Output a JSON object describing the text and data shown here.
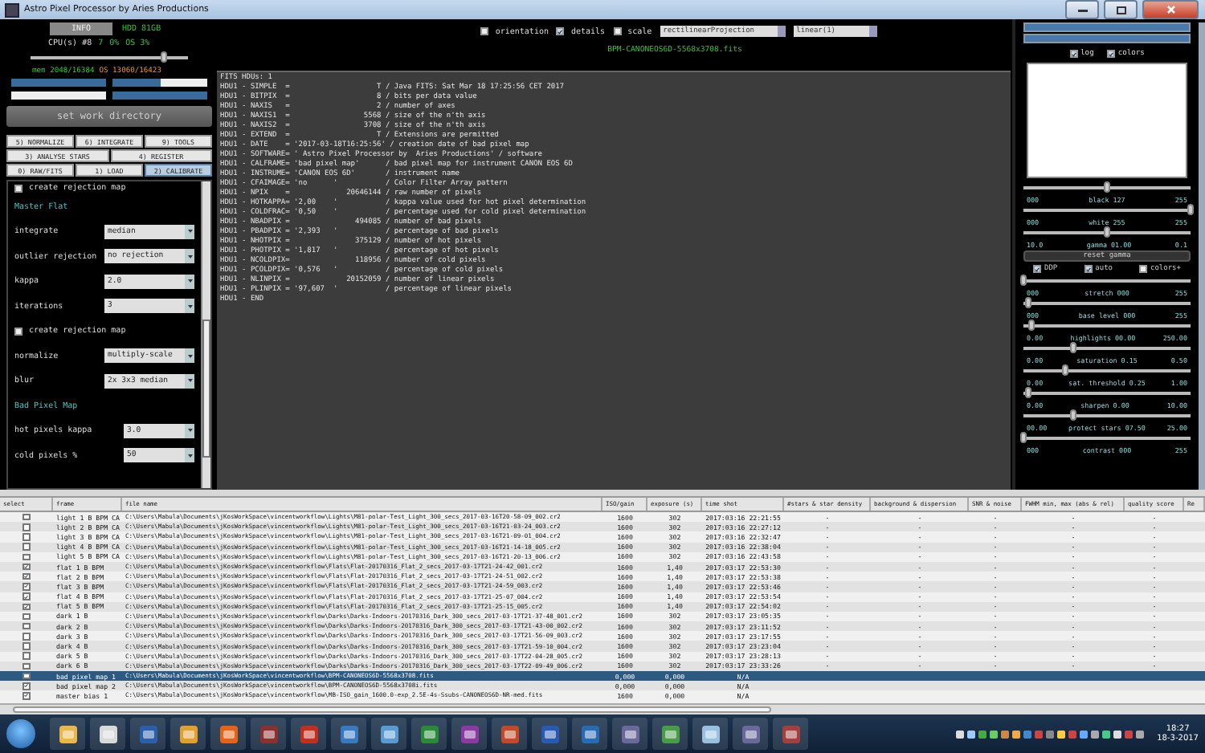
{
  "window": {
    "title": "Astro Pixel Processor by Aries Productions"
  },
  "system": {
    "info_button": "INFO",
    "hdd": "HDD 81GB",
    "cpu": [
      "CPU(s) #8",
      "7",
      "0%",
      "OS 3%"
    ],
    "cpu_slider": {
      "level": 0.85
    },
    "mem": "mem 2048/16384",
    "mem_os": "OS 13060/16423",
    "meters": [
      {
        "level": 1
      },
      {
        "level": 0.5
      },
      {
        "level": 0
      },
      {
        "level": 1
      }
    ],
    "work_dir_button": "set work directory"
  },
  "tabs": [
    [
      {
        "label": "5) NORMALIZE",
        "selected": false
      },
      {
        "label": "6) INTEGRATE",
        "selected": false
      },
      {
        "label": "9) TOOLS",
        "selected": false
      }
    ],
    [
      {
        "label": "3) ANALYSE STARS",
        "selected": false
      },
      {
        "label": "4) REGISTER",
        "selected": false
      }
    ],
    [
      {
        "label": "0) RAW/FITS",
        "selected": false
      },
      {
        "label": "1) LOAD",
        "selected": false
      },
      {
        "label": "2) CALIBRATE",
        "selected": true
      }
    ]
  ],
  "settings": [
    {
      "kind": "checkbox",
      "label": "create rejection map",
      "checked": false
    },
    {
      "kind": "heading",
      "label": "Master Flat"
    },
    {
      "kind": "select",
      "label": "integrate",
      "value": "median"
    },
    {
      "kind": "select",
      "label": "outlier rejection",
      "value": "no rejection"
    },
    {
      "kind": "select",
      "label": "kappa",
      "value": "2.0"
    },
    {
      "kind": "select",
      "label": "iterations",
      "value": "3"
    },
    {
      "kind": "checkbox",
      "label": "create rejection map",
      "checked": false
    },
    {
      "kind": "select",
      "label": "normalize",
      "value": "multiply-scale"
    },
    {
      "kind": "select",
      "label": "blur",
      "value": "2x 3x3 median"
    },
    {
      "kind": "heading",
      "label": "Bad Pixel Map"
    },
    {
      "kind": "select",
      "label": "hot pixels kappa",
      "value": "3.0"
    },
    {
      "kind": "select",
      "label": "cold pixels %",
      "value": "50"
    }
  ],
  "viewer": {
    "options": [
      {
        "label": "orientation",
        "checked": false
      },
      {
        "label": "details",
        "checked": true
      },
      {
        "label": "scale",
        "checked": false
      }
    ],
    "projection": "rectilinearProjection",
    "stretch": "linear(1)",
    "file": "BPM-CANONEOS6D-5568x3708.fits",
    "header_lines": [
      "FITS HDUs: 1",
      "HDU1 - SIMPLE  =                    T / Java FITS: Sat Mar 18 17:25:56 CET 2017",
      "HDU1 - BITPIX  =                    8 / bits per data value",
      "HDU1 - NAXIS   =                    2 / number of axes",
      "HDU1 - NAXIS1  =                 5568 / size of the n'th axis",
      "HDU1 - NAXIS2  =                 3708 / size of the n'th axis",
      "HDU1 - EXTEND  =                    T / Extensions are permitted",
      "HDU1 - DATE    = '2017-03-18T16:25:56' / creation date of bad pixel map",
      "HDU1 - SOFTWARE= ' Astro Pixel Processor by  Aries Productions' / software",
      "HDU1 - CALFRAME= 'bad pixel map'      / bad pixel map for instrument CANON EOS 6D",
      "HDU1 - INSTRUME= 'CANON EOS 6D'       / instrument name",
      "HDU1 - CFAIMAGE= 'no      '           / Color Filter Array pattern",
      "HDU1 - NPIX    =             20646144 / raw number of pixels",
      "HDU1 - HOTKAPPA= '2,00    '           / kappa value used for hot pixel determination",
      "HDU1 - COLDFRAC= '0,50    '           / percentage used for cold pixel determination",
      "HDU1 - NBADPIX =               494085 / number of bad pixels",
      "HDU1 - PBADPIX = '2,393   '           / percentage of bad pixels",
      "HDU1 - NHOTPIX =               375129 / number of hot pixels",
      "HDU1 - PHOTPIX = '1,817   '           / percentage of hot pixels",
      "HDU1 - NCOLDPIX=               118956 / number of cold pixels",
      "HDU1 - PCOLDPIX= '0,576   '           / percentage of cold pixels",
      "HDU1 - NLINPIX =             20152059 / number of linear pixels",
      "HDU1 - PLINPIX = '97,607  '           / percentage of linear pixels",
      "HDU1 - END"
    ]
  },
  "adjust": {
    "histogram_options": [
      {
        "label": "log",
        "checked": true
      },
      {
        "label": "colors",
        "checked": true
      }
    ],
    "controls": [
      {
        "kind": "slider",
        "level": 0.5,
        "min": "000",
        "label": "black 127",
        "max": "255"
      },
      {
        "kind": "slider",
        "level": 1,
        "min": "000",
        "label": "white 255",
        "max": "255"
      },
      {
        "kind": "slider",
        "level": 0.5,
        "min": "10.0",
        "label": "gamma 01.00",
        "max": "0.1"
      },
      {
        "kind": "button",
        "label": "reset gamma"
      },
      {
        "kind": "checks",
        "items": [
          {
            "label": "DDP",
            "checked": true
          },
          {
            "label": "auto",
            "checked": true
          },
          {
            "label": "colors+",
            "checked": false
          }
        ]
      },
      {
        "kind": "slider",
        "level": 0,
        "min": "000",
        "label": "stretch 000",
        "max": "255"
      },
      {
        "kind": "slider",
        "level": 0.03,
        "min": "000",
        "label": "base level 000",
        "max": "255"
      },
      {
        "kind": "slider",
        "level": 0.05,
        "min": "0.00",
        "label": "highlights 00.00",
        "max": "250.00"
      },
      {
        "kind": "slider",
        "level": 0.3,
        "min": "0.00",
        "label": "saturation 0.15",
        "max": "0.50"
      },
      {
        "kind": "slider",
        "level": 0.25,
        "min": "0.00",
        "label": "sat. threshold 0.25",
        "max": "1.00"
      },
      {
        "kind": "slider",
        "level": 0.03,
        "min": "0.00",
        "label": "sharpen 0.00",
        "max": "10.00"
      },
      {
        "kind": "slider",
        "level": 0.3,
        "min": "00.00",
        "label": "protect stars 07.50",
        "max": "25.00"
      },
      {
        "kind": "slider",
        "level": 0,
        "min": "000",
        "label": "contrast 000",
        "max": "255"
      }
    ]
  },
  "table": {
    "select_column": "select",
    "columns": [
      "frame",
      "file name",
      "ISO/gain",
      "exposure (s)",
      "time shot",
      "#stars & star density",
      "background & dispersion",
      "SNR & noise",
      "FWHM min, max (abs & rel)",
      "quality score",
      "Re"
    ],
    "rows": [
      {
        "checked": false,
        "selected": false,
        "cells": [
          "light 1 B BPM CA",
          "C:\\Users\\Mabula\\Documents\\jKosWorkSpace\\vincentworkflow\\Lights\\M81-polar-Test_Light_300_secs_2017-03-16T20-58-09_002.cr2",
          "1600",
          "302",
          "2017:03:16 22:21:55",
          "-",
          "-",
          "-",
          "-",
          "-"
        ]
      },
      {
        "checked": false,
        "selected": false,
        "cells": [
          "light 2 B BPM CA",
          "C:\\Users\\Mabula\\Documents\\jKosWorkSpace\\vincentworkflow\\Lights\\M81-polar-Test_Light_300_secs_2017-03-16T21-03-24_003.cr2",
          "1600",
          "302",
          "2017:03:16 22:27:12",
          "-",
          "-",
          "-",
          "-",
          "-"
        ]
      },
      {
        "checked": false,
        "selected": false,
        "cells": [
          "light 3 B BPM CA",
          "C:\\Users\\Mabula\\Documents\\jKosWorkSpace\\vincentworkflow\\Lights\\M81-polar-Test_Light_300_secs_2017-03-16T21-09-01_004.cr2",
          "1600",
          "302",
          "2017:03:16 22:32:47",
          "-",
          "-",
          "-",
          "-",
          "-"
        ]
      },
      {
        "checked": false,
        "selected": false,
        "cells": [
          "light 4 B BPM CA",
          "C:\\Users\\Mabula\\Documents\\jKosWorkSpace\\vincentworkflow\\Lights\\M81-polar-Test_Light_300_secs_2017-03-16T21-14-18_005.cr2",
          "1600",
          "302",
          "2017:03:16 22:38:04",
          "-",
          "-",
          "-",
          "-",
          "-"
        ]
      },
      {
        "checked": false,
        "selected": false,
        "cells": [
          "light 5 B BPM CA",
          "C:\\Users\\Mabula\\Documents\\jKosWorkSpace\\vincentworkflow\\Lights\\M81-polar-Test_Light_300_secs_2017-03-16T21-20-13_006.cr2",
          "1600",
          "302",
          "2017:03:16 22:43:58",
          "-",
          "-",
          "-",
          "-",
          "-"
        ]
      },
      {
        "checked": true,
        "selected": false,
        "cells": [
          "flat 1 B BPM",
          "C:\\Users\\Mabula\\Documents\\jKosWorkSpace\\vincentworkflow\\Flats\\Flat-20170316_Flat_2_secs_2017-03-17T21-24-42_001.cr2",
          "1600",
          "1,40",
          "2017:03:17 22:53:30",
          "-",
          "-",
          "-",
          "-",
          "-"
        ]
      },
      {
        "checked": true,
        "selected": false,
        "cells": [
          "flat 2 B BPM",
          "C:\\Users\\Mabula\\Documents\\jKosWorkSpace\\vincentworkflow\\Flats\\Flat-20170316_Flat_2_secs_2017-03-17T21-24-51_002.cr2",
          "1600",
          "1,40",
          "2017:03:17 22:53:38",
          "-",
          "-",
          "-",
          "-",
          "-"
        ]
      },
      {
        "checked": true,
        "selected": false,
        "cells": [
          "flat 3 B BPM",
          "C:\\Users\\Mabula\\Documents\\jKosWorkSpace\\vincentworkflow\\Flats\\Flat-20170316_Flat_2_secs_2017-03-17T21-24-59_003.cr2",
          "1600",
          "1,40",
          "2017:03:17 22:53:46",
          "-",
          "-",
          "-",
          "-",
          "-"
        ]
      },
      {
        "checked": true,
        "selected": false,
        "cells": [
          "flat 4 B BPM",
          "C:\\Users\\Mabula\\Documents\\jKosWorkSpace\\vincentworkflow\\Flats\\Flat-20170316_Flat_2_secs_2017-03-17T21-25-07_004.cr2",
          "1600",
          "1,40",
          "2017:03:17 22:53:54",
          "-",
          "-",
          "-",
          "-",
          "-"
        ]
      },
      {
        "checked": true,
        "selected": false,
        "cells": [
          "flat 5 B BPM",
          "C:\\Users\\Mabula\\Documents\\jKosWorkSpace\\vincentworkflow\\Flats\\Flat-20170316_Flat_2_secs_2017-03-17T21-25-15_005.cr2",
          "1600",
          "1,40",
          "2017:03:17 22:54:02",
          "-",
          "-",
          "-",
          "-",
          "-"
        ]
      },
      {
        "checked": false,
        "selected": false,
        "cells": [
          "dark 1 B",
          "C:\\Users\\Mabula\\Documents\\jKosWorkSpace\\vincentworkflow\\Darks\\Darks-Indoors-20170316_Dark_300_secs_2017-03-17T21-37-48_001.cr2",
          "1600",
          "302",
          "2017:03:17 23:05:35",
          "-",
          "-",
          "-",
          "-",
          "-"
        ]
      },
      {
        "checked": false,
        "selected": false,
        "cells": [
          "dark 2 B",
          "C:\\Users\\Mabula\\Documents\\jKosWorkSpace\\vincentworkflow\\Darks\\Darks-Indoors-20170316_Dark_300_secs_2017-03-17T21-43-00_002.cr2",
          "1600",
          "302",
          "2017:03:17 23:11:52",
          "-",
          "-",
          "-",
          "-",
          "-"
        ]
      },
      {
        "checked": false,
        "selected": false,
        "cells": [
          "dark 3 B",
          "C:\\Users\\Mabula\\Documents\\jKosWorkSpace\\vincentworkflow\\Darks\\Darks-Indoors-20170316_Dark_300_secs_2017-03-17T21-56-09_003.cr2",
          "1600",
          "302",
          "2017:03:17 23:17:55",
          "-",
          "-",
          "-",
          "-",
          "-"
        ]
      },
      {
        "checked": false,
        "selected": false,
        "cells": [
          "dark 4 B",
          "C:\\Users\\Mabula\\Documents\\jKosWorkSpace\\vincentworkflow\\Darks\\Darks-Indoors-20170316_Dark_300_secs_2017-03-17T21-59-10_004.cr2",
          "1600",
          "302",
          "2017:03:17 23:23:04",
          "-",
          "-",
          "-",
          "-",
          "-"
        ]
      },
      {
        "checked": false,
        "selected": false,
        "cells": [
          "dark 5 B",
          "C:\\Users\\Mabula\\Documents\\jKosWorkSpace\\vincentworkflow\\Darks\\Darks-Indoors-20170316_Dark_300_secs_2017-03-17T22-04-28_005.cr2",
          "1600",
          "302",
          "2017:03:17 23:28:13",
          "-",
          "-",
          "-",
          "-",
          "-"
        ]
      },
      {
        "checked": false,
        "selected": false,
        "cells": [
          "dark 6 B",
          "C:\\Users\\Mabula\\Documents\\jKosWorkSpace\\vincentworkflow\\Darks\\Darks-Indoors-20170316_Dark_300_secs_2017-03-17T22-09-49_006.cr2",
          "1600",
          "302",
          "2017:03:17 23:33:26",
          "-",
          "-",
          "-",
          "-",
          "-"
        ]
      },
      {
        "checked": false,
        "selected": true,
        "cells": [
          "bad pixel map 1",
          "C:\\Users\\Mabula\\Documents\\jKosWorkSpace\\vincentworkflow\\BPM-CANONEOS6D-5568x3708.fits",
          "0,000",
          "0,000",
          "N/A"
        ]
      },
      {
        "checked": true,
        "selected": false,
        "cells": [
          "bad pixel map 2",
          "C:\\Users\\Mabula\\Documents\\jKosWorkSpace\\vincentworkflow\\BPM-CANONEOS6D-5568x3708i.fits",
          "0,000",
          "0,000",
          "N/A"
        ]
      },
      {
        "checked": true,
        "selected": false,
        "cells": [
          "master bias 1",
          "C:\\Users\\Mabula\\Documents\\jKosWorkSpace\\vincentworkflow\\MB-ISO_gain_1600.0-exp_2.5E-4s-Ssubs-CANONEOS6D-NR-med.fits",
          "1600",
          "0,000",
          "N/A"
        ]
      }
    ]
  },
  "taskbar": {
    "time": "18:27",
    "date": "18-3-2017"
  }
}
